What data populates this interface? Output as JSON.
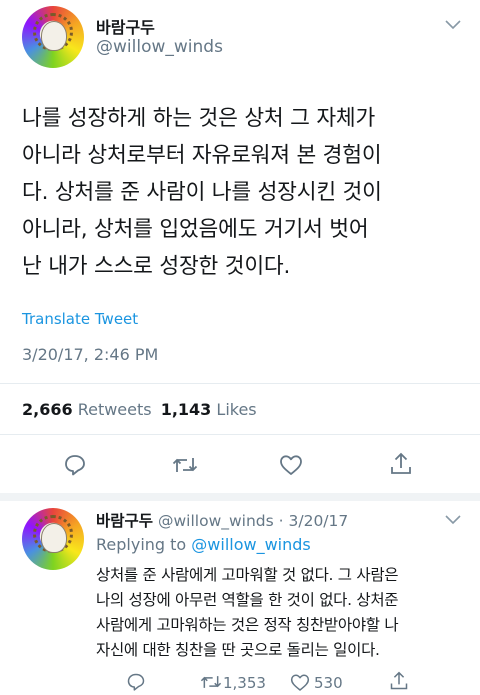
{
  "main_tweet": {
    "display_name": "바람구두",
    "handle": "@willow_winds",
    "text_lines": [
      "나를 성장하게 하는 것은 상처 그 자체가",
      "아니라 상처로부터 자유로워져 본 경험이",
      "다. 상처를 준 사람이 나를 성장시킨 것이",
      "아니라, 상처를 입었음에도 거기서 벗어",
      "난 내가 스스로 성장한 것이다."
    ],
    "translate_label": "Translate Tweet",
    "timestamp": "3/20/17, 2:46 PM",
    "retweets_count": "2,666",
    "retweets_label": "Retweets",
    "likes_count": "1,143",
    "likes_label": "Likes"
  },
  "reply": {
    "display_name": "바람구두",
    "handle_date": "@willow_winds · 3/20/17",
    "replying_prefix": "Replying to",
    "replying_handle": "@willow_winds",
    "text_lines": [
      "상처를 준 사람에게 고마워할 것 없다. 그 사람은",
      "나의 성장에 아무런 역할을 한 것이 없다. 상처준",
      "사람에게 고마워하는 것은 정작 칭찬받아야할 나",
      "자신에 대한 칭찬을 딴 곳으로 돌리는 일이다."
    ],
    "retweets_count": "1,353",
    "likes_count": "530"
  },
  "colors": {
    "text": "#14171a",
    "muted": "#657786",
    "link": "#1b95e0",
    "divider": "#e6ecf0"
  },
  "icons": [
    "chevron-down-icon",
    "reply-icon",
    "retweet-icon",
    "like-icon",
    "share-icon"
  ]
}
